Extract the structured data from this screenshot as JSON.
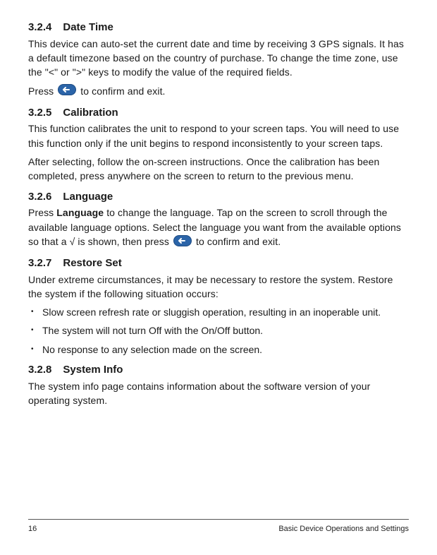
{
  "sections": [
    {
      "num": "3.2.4",
      "title": "Date Time",
      "paras": [
        {
          "text": "This device can auto-set the current date and time by receiving 3 GPS signals. It has a default timezone based on the country of purchase. To change the time zone, use the \"<\" or \">\" keys to modify the value of the required fields."
        },
        {
          "parts": [
            "Press ",
            "{back}",
            " to confirm and exit."
          ]
        }
      ]
    },
    {
      "num": "3.2.5",
      "title": "Calibration",
      "paras": [
        {
          "text": "This function calibrates the unit to respond to your screen taps. You will need to use this function only if the unit begins to respond inconsistently to your screen taps."
        },
        {
          "text": "After selecting, follow the on-screen instructions. Once the calibration has been completed, press anywhere on the screen to return to the previous menu."
        }
      ]
    },
    {
      "num": "3.2.6",
      "title": "Language",
      "paras": [
        {
          "parts": [
            "Press ",
            {
              "bold": "Language"
            },
            " to change the language. Tap on the screen to scroll through the available language options. Select the language you want from the available options so that a √ is shown, then press ",
            "{back}",
            " to confirm and exit."
          ]
        }
      ]
    },
    {
      "num": "3.2.7",
      "title": "Restore Set",
      "paras": [
        {
          "text": "Under extreme circumstances, it may be necessary to restore the system. Restore the system if the following situation occurs:"
        }
      ],
      "bullets": [
        "Slow screen refresh rate or sluggish operation, resulting in an inoperable unit.",
        "The system will not turn Off with the On/Off button.",
        "No response to any selection made on the screen."
      ]
    },
    {
      "num": "3.2.8",
      "title": "System Info",
      "paras": [
        {
          "text": "The system info page contains information about the software version of your operating system."
        }
      ]
    }
  ],
  "footer": {
    "page": "16",
    "chapter": "Basic Device Operations and Settings"
  },
  "icons": {
    "back_title": "back / confirm"
  }
}
